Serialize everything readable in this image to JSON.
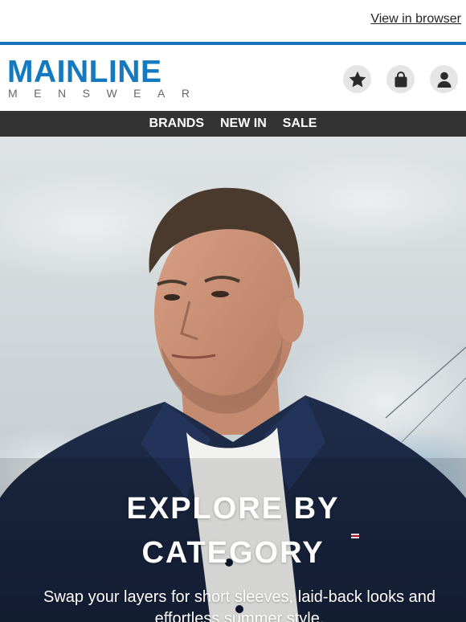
{
  "topbar": {
    "view_in_browser": "View in browser"
  },
  "brand": {
    "name": "MAINLINE",
    "tagline": "MENSWEAR",
    "color": "#1579c0"
  },
  "header_icons": [
    {
      "name": "star-icon",
      "label": "Wishlist"
    },
    {
      "name": "bag-icon",
      "label": "Basket"
    },
    {
      "name": "user-icon",
      "label": "Account"
    }
  ],
  "nav": {
    "items": [
      {
        "label": "BRANDS"
      },
      {
        "label": "NEW IN"
      },
      {
        "label": "SALE"
      }
    ]
  },
  "hero": {
    "title_line1": "EXPLORE BY",
    "title_line2": "CATEGORY",
    "subtitle": "Swap your layers for short sleeves, laid-back looks and effortless summer style."
  },
  "colors": {
    "accent_rule": "#1a73b8",
    "nav_bg": "#333333"
  }
}
